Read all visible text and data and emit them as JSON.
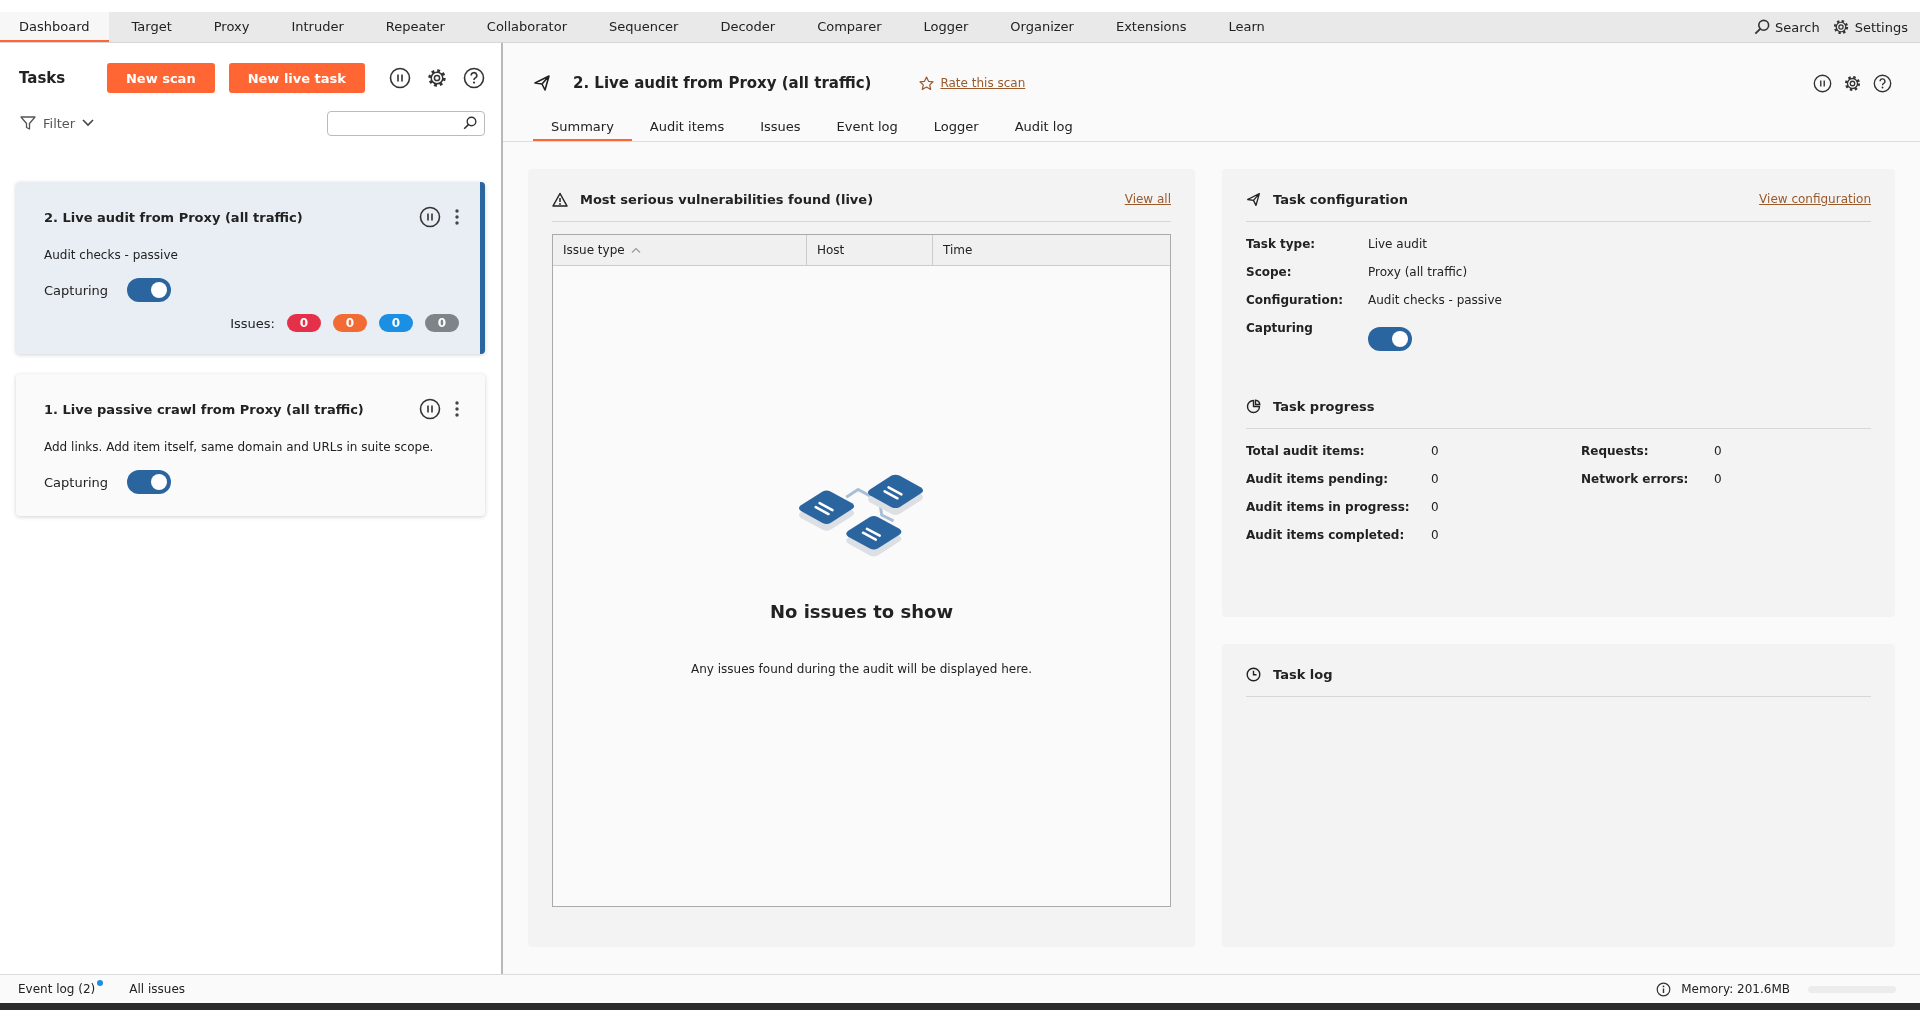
{
  "top_tabs": [
    {
      "label": "Dashboard",
      "selected": true
    },
    {
      "label": "Target",
      "selected": false
    },
    {
      "label": "Proxy",
      "selected": false
    },
    {
      "label": "Intruder",
      "selected": false
    },
    {
      "label": "Repeater",
      "selected": false
    },
    {
      "label": "Collaborator",
      "selected": false
    },
    {
      "label": "Sequencer",
      "selected": false
    },
    {
      "label": "Decoder",
      "selected": false
    },
    {
      "label": "Comparer",
      "selected": false
    },
    {
      "label": "Logger",
      "selected": false
    },
    {
      "label": "Organizer",
      "selected": false
    },
    {
      "label": "Extensions",
      "selected": false
    },
    {
      "label": "Learn",
      "selected": false
    }
  ],
  "top_actions": [
    {
      "label": "Search",
      "kind": "search"
    },
    {
      "label": "Settings",
      "kind": "settings"
    }
  ],
  "tasks_panel": {
    "title": "Tasks",
    "buttons": [
      "New scan",
      "New live task"
    ],
    "filter": "Filter"
  },
  "tasks": [
    {
      "title": "2. Live audit from Proxy (all traffic)",
      "description": "Audit checks - passive",
      "capturing_label": "Capturing",
      "capturing": true,
      "selected": true,
      "issues_label": "Issues:",
      "issues": [
        {
          "count": "0",
          "color": "#e5304a"
        },
        {
          "count": "0",
          "color": "#f26b35"
        },
        {
          "count": "0",
          "color": "#1a8fe3"
        },
        {
          "count": "0",
          "color": "#7f8489"
        }
      ]
    },
    {
      "title": "1. Live passive crawl from Proxy (all traffic)",
      "description": "Add links. Add item itself, same domain and URLs in suite scope.",
      "capturing_label": "Capturing",
      "capturing": true,
      "selected": false
    }
  ],
  "detail": {
    "title": "2. Live audit from Proxy (all traffic)",
    "rate_link": "Rate this scan",
    "tabs": [
      {
        "label": "Summary",
        "selected": true
      },
      {
        "label": "Audit items",
        "selected": false
      },
      {
        "label": "Issues",
        "selected": false
      },
      {
        "label": "Event log",
        "selected": false
      },
      {
        "label": "Logger",
        "selected": false
      },
      {
        "label": "Audit log",
        "selected": false
      }
    ],
    "vulnerabilities": {
      "title": "Most serious vulnerabilities found (live)",
      "view_all": "View all",
      "columns": [
        {
          "label": "Issue type",
          "sorted": true
        },
        {
          "label": "Host",
          "sorted": false
        },
        {
          "label": "Time",
          "sorted": false
        }
      ],
      "empty_title": "No issues to show",
      "empty_text": "Any issues found during the audit will be displayed here."
    },
    "configuration": {
      "title": "Task configuration",
      "link": "View configuration",
      "fields": [
        {
          "label": "Task type:",
          "value": "Live audit"
        },
        {
          "label": "Scope:",
          "value": "Proxy (all traffic)"
        },
        {
          "label": "Configuration:",
          "value": "Audit checks - passive"
        }
      ],
      "capturing_label": "Capturing",
      "capturing": true
    },
    "progress": {
      "title": "Task progress",
      "left": [
        {
          "label": "Total audit items:",
          "value": "0"
        },
        {
          "label": "Audit items pending:",
          "value": "0"
        },
        {
          "label": "Audit items in progress:",
          "value": "0"
        },
        {
          "label": "Audit items completed:",
          "value": "0"
        }
      ],
      "right": [
        {
          "label": "Requests:",
          "value": "0"
        },
        {
          "label": "Network errors:",
          "value": "0"
        }
      ]
    },
    "task_log": {
      "title": "Task log"
    }
  },
  "status_bar": {
    "event_log": "Event log (2)",
    "event_log_unread": true,
    "all_issues": "All issues",
    "memory": "Memory: 201.6MB"
  }
}
